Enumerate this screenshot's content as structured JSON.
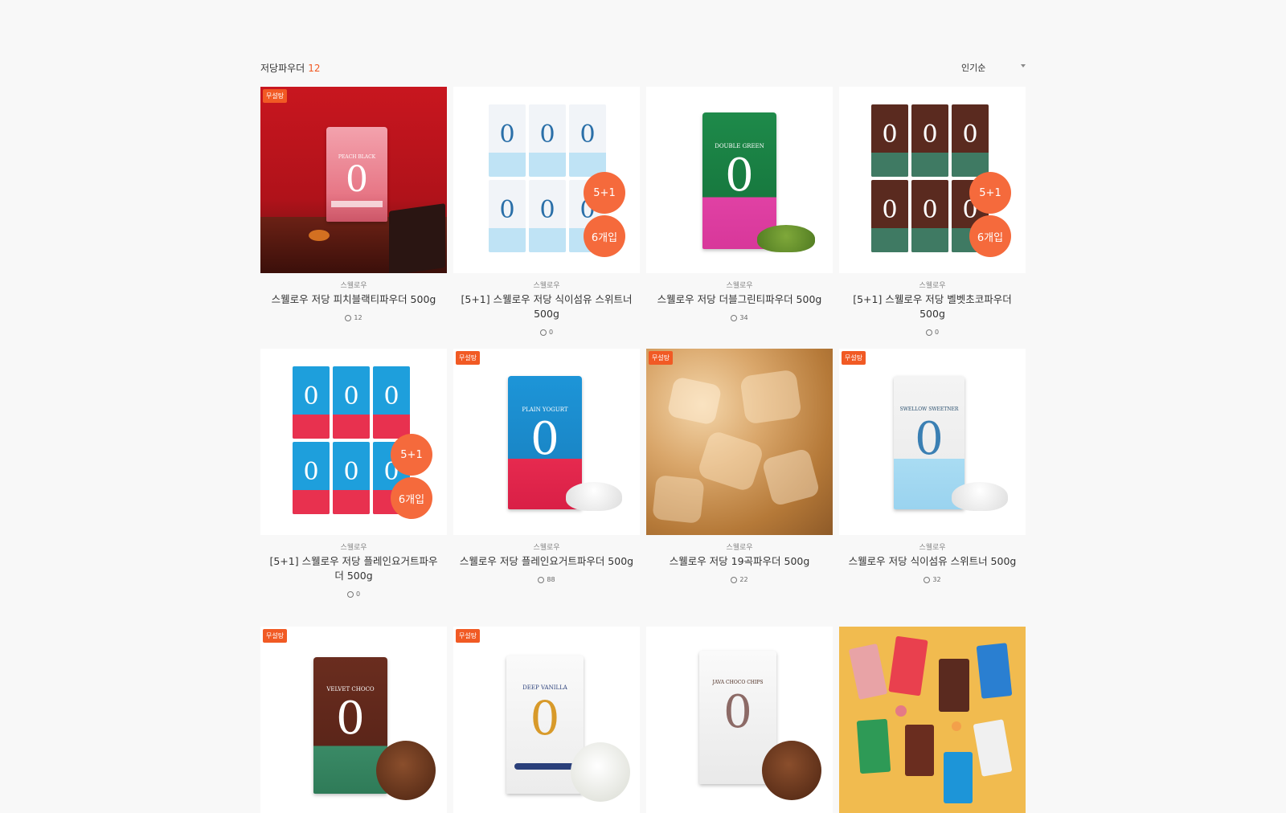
{
  "category": {
    "title": "저당파우더",
    "count": "12"
  },
  "sort": {
    "label": "인기순"
  },
  "products": [
    {
      "badge": "무설탕",
      "brand": "스웰로우",
      "name": "스웰로우 저당 피치블랙티파우더 500g",
      "reviews": "12",
      "pack_word": "PEACH BLACK"
    },
    {
      "brand": "스웰로우",
      "name": "[5+1] 스웰로우 저당 식이섬유 스위트너 500g",
      "reviews": "0",
      "promo1": "5+1",
      "promo2": "6개입"
    },
    {
      "brand": "스웰로우",
      "name": "스웰로우 저당 더블그린티파우더 500g",
      "reviews": "34",
      "pack_word": "DOUBLE GREEN"
    },
    {
      "brand": "스웰로우",
      "name": "[5+1] 스웰로우 저당 벨벳초코파우더 500g",
      "reviews": "0",
      "promo1": "5+1",
      "promo2": "6개입"
    },
    {
      "brand": "스웰로우",
      "name": "[5+1] 스웰로우 저당 플레인요거트파우더 500g",
      "reviews": "0",
      "promo1": "5+1",
      "promo2": "6개입"
    },
    {
      "badge": "무설탕",
      "brand": "스웰로우",
      "name": "스웰로우 저당 플레인요거트파우더 500g",
      "reviews": "88",
      "pack_word": "PLAIN YOGURT"
    },
    {
      "badge": "무설탕",
      "brand": "스웰로우",
      "name": "스웰로우 저당 19곡파우더 500g",
      "reviews": "22"
    },
    {
      "badge": "무설탕",
      "brand": "스웰로우",
      "name": "스웰로우 저당 식이섬유 스위트너 500g",
      "reviews": "32",
      "pack_word": "SWELLOW SWEETNER"
    },
    {
      "badge": "무설탕",
      "pack_word": "VELVET CHOCO"
    },
    {
      "badge": "무설탕",
      "pack_word": "DEEP VANILLA"
    },
    {
      "pack_word": "JAVA CHOCO CHIPS"
    },
    {}
  ],
  "colors": {
    "accent": "#f15a24",
    "promo": "#f56a3c"
  },
  "icons": {
    "review": "speech-bubble-icon",
    "sort": "caret-down-icon"
  }
}
